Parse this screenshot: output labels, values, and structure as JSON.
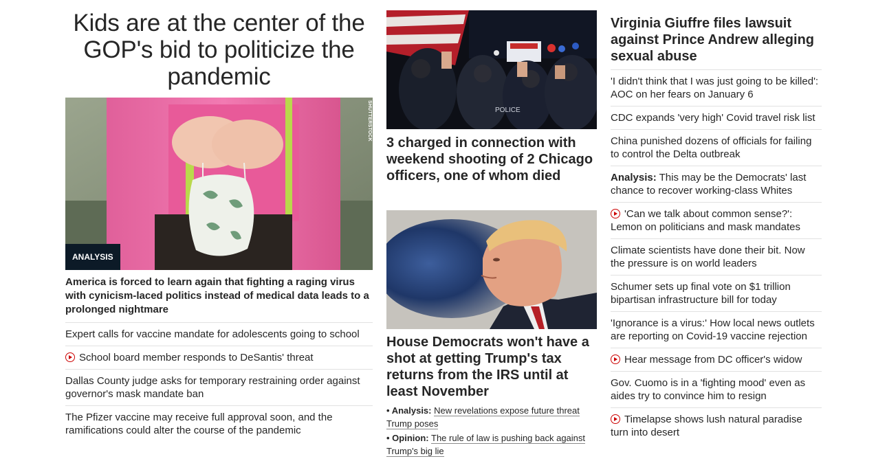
{
  "col1": {
    "headline": "Kids are at the center of the GOP's bid to politicize the pandemic",
    "image": {
      "credit": "SHUTTERSTOCK",
      "badge": "ANALYSIS"
    },
    "lead": "America is forced to learn again that fighting a raging virus with cynicism-laced politics instead of medical data leads to a prolonged nightmare",
    "items": [
      {
        "text": "Expert calls for vaccine mandate for adolescents going to school"
      },
      {
        "video": true,
        "text": "School board member responds to DeSantis' threat"
      },
      {
        "text": "Dallas County judge asks for temporary restraining order against governor's mask mandate ban"
      },
      {
        "text": "The Pfizer vaccine may receive full approval soon, and the ramifications could alter the course of the pandemic"
      }
    ]
  },
  "col2": {
    "story1": {
      "headline": "3 charged in connection with weekend shooting of 2 Chicago officers, one of whom died",
      "patch_text": "POLICE"
    },
    "story2": {
      "headline": "House Democrats won't have a shot at getting Trump's tax returns from the IRS until at least November",
      "links": [
        {
          "bullet": "• ",
          "label": "Analysis:",
          "text": "New revelations expose future threat Trump poses"
        },
        {
          "bullet": "• ",
          "label": "Opinion:",
          "text": "The rule of law is pushing back against Trump's big lie"
        }
      ]
    }
  },
  "col3": {
    "headline": "Virginia Giuffre files lawsuit against Prince Andrew alleging sexual abuse",
    "items": [
      {
        "text": "'I didn't think that I was just going to be killed': AOC on her fears on January 6"
      },
      {
        "text": "CDC expands 'very high' Covid travel risk list"
      },
      {
        "text": "China punished dozens of officials for failing to control the Delta outbreak"
      },
      {
        "label": "Analysis:",
        "text": "This may be the Democrats' last chance to recover working-class Whites"
      },
      {
        "video": true,
        "text": "'Can we talk about common sense?': Lemon on politicians and mask mandates"
      },
      {
        "text": "Climate scientists have done their bit. Now the pressure is on world leaders"
      },
      {
        "text": "Schumer sets up final vote on $1 trillion bipartisan infrastructure bill for today"
      },
      {
        "text": "'Ignorance is a virus:' How local news outlets are reporting on Covid-19 vaccine rejection"
      },
      {
        "video": true,
        "text": "Hear message from DC officer's widow"
      },
      {
        "text": "Gov. Cuomo is in a 'fighting mood' even as aides try to convince him to resign"
      },
      {
        "video": true,
        "text": "Timelapse shows lush natural paradise turn into desert"
      }
    ]
  },
  "colors": {
    "accent_red": "#cc0000",
    "badge_bg": "#0c1a27",
    "text": "#262626",
    "divider": "#e1e1e1"
  }
}
